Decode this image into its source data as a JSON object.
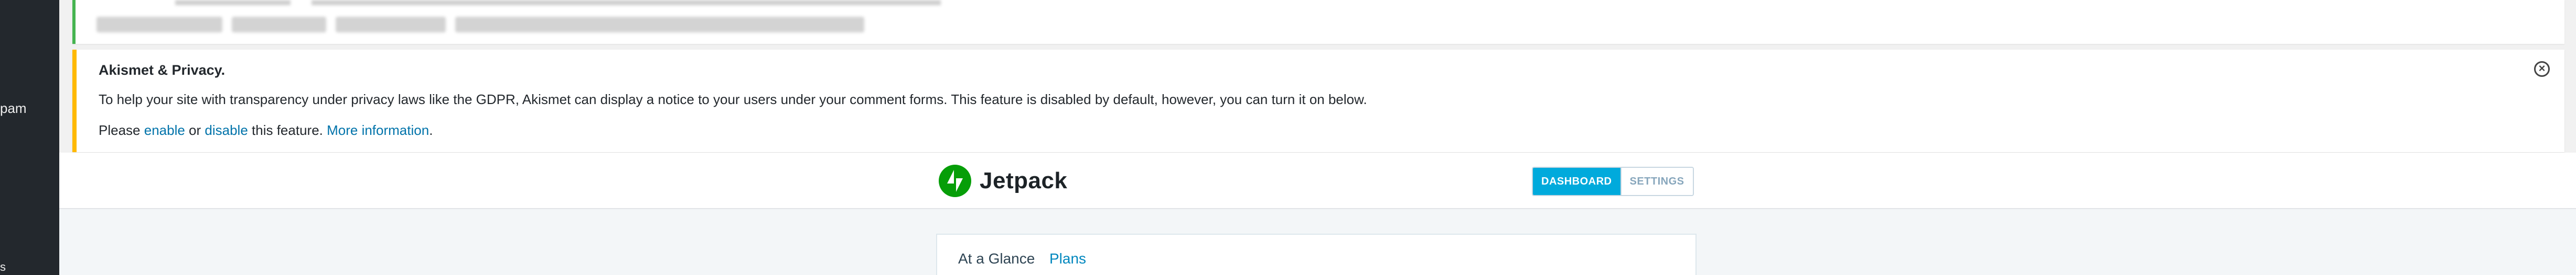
{
  "sidebar": {
    "partial_label": "pam",
    "partial_glyph": "s"
  },
  "notice_akismet": {
    "title": "Akismet & Privacy.",
    "body": "To help your site with transparency under privacy laws like the GDPR, Akismet can display a notice to your users under your comment forms. This feature is disabled by default, however, you can turn it on below.",
    "links_prefix": "Please ",
    "enable_label": "enable",
    "or_text": " or ",
    "disable_label": "disable",
    "links_suffix": " this feature. ",
    "more_info_label": "More information",
    "period": ".",
    "close_symbol": "×"
  },
  "jetpack_header": {
    "logo_text": "Jetpack",
    "tabs": [
      {
        "label": "DASHBOARD",
        "active": true
      },
      {
        "label": "SETTINGS",
        "active": false
      }
    ]
  },
  "jetpack_nav": {
    "items": [
      {
        "label": "At a Glance"
      },
      {
        "label": "Plans"
      }
    ]
  },
  "colors": {
    "sidebar_bg": "#23282d",
    "success_border": "#46b450",
    "warning_border": "#ffb900",
    "link": "#0073aa",
    "jetpack_green": "#069e08",
    "tab_active": "#00aadc"
  },
  "icons": {
    "jetpack_logo": "jetpack-bolt-icon",
    "close": "close-circle-icon"
  }
}
